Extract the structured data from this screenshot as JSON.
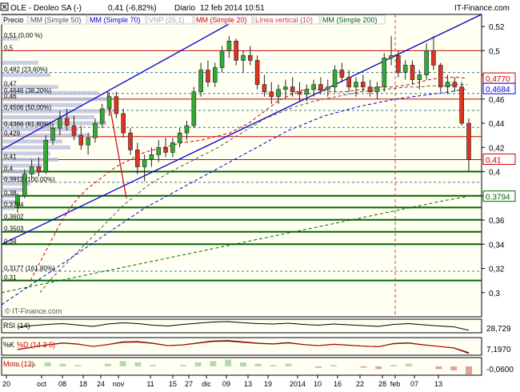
{
  "header": {
    "symbol": "OLE - Deoleo SA (-)",
    "quote": "0,41 (-6,82%)",
    "period": "Diario",
    "date": "12 feb 2014 10:51",
    "brand": "IT-Finance.com",
    "close_icon": "close-box-icon"
  },
  "legend": [
    {
      "label": "Precio",
      "color": "#000000"
    },
    {
      "label": "MM (Simple 50)",
      "color": "#555555"
    },
    {
      "label": "MM (Simple 70)",
      "color": "#0000cc"
    },
    {
      "label": "VNP (25,1)",
      "color": "#aaaaaa"
    },
    {
      "label": "MM (Simple 20)",
      "color": "#cc0000"
    },
    {
      "label": "Línea vertical (10)",
      "color": "#cc4444"
    },
    {
      "label": "MM (Simple 200)",
      "color": "#006600"
    }
  ],
  "watermark": "© IT-Finance.com",
  "indicators": {
    "rsi": {
      "label": "RSI (14)",
      "value": "28,729"
    },
    "stoch": {
      "label_k": "%K",
      "label_d": "%D (14 3 5)",
      "value": "7,1970"
    },
    "mom": {
      "label": "Mom (12)",
      "value": "-0,0600"
    }
  },
  "colors": {
    "up": "#33aa33",
    "down": "#dd3322",
    "fib": "#cc0000",
    "support": "#006600",
    "trend": "#0000cc",
    "ma50": "#555555",
    "ma20": "#cc0000",
    "ma70": "#0000cc",
    "ma200": "#006600",
    "last_price": "#cc0000"
  },
  "chart_data": {
    "type": "candlestick",
    "x_tick_labels": [
      "20",
      "oct",
      "08",
      "18",
      "24",
      "nov",
      "11",
      "15",
      "27",
      "dic",
      "09",
      "13",
      "19",
      "2014",
      "10",
      "16",
      "22",
      "28",
      "feb",
      "07",
      "13"
    ],
    "ylim": [
      0.28,
      0.53
    ],
    "y_ticks": [
      "0,52",
      "0,5",
      "0,48",
      "0,46",
      "0,44",
      "0,42",
      "0,4",
      "0,38",
      "0,36",
      "0,34",
      "0,32",
      "0,3"
    ],
    "price_tags": [
      {
        "label": "0,4770",
        "value": 0.477,
        "color": "#cc0000"
      },
      {
        "label": "0,4684",
        "value": 0.4684,
        "color": "#0000cc"
      },
      {
        "label": "0,41",
        "value": 0.41,
        "color": "#cc0000"
      },
      {
        "label": "0,3794",
        "value": 0.3794,
        "color": "#006600"
      }
    ],
    "level_labels": [
      {
        "label": "0,51 (0,00 %)",
        "value": 0.51
      },
      {
        "label": "0,5",
        "value": 0.5
      },
      {
        "label": "0,482 (23,60%)",
        "value": 0.482
      },
      {
        "label": "0,47",
        "value": 0.47
      },
      {
        "label": "0,4646 (38,20%)",
        "value": 0.4646
      },
      {
        "label": "0,46",
        "value": 0.46
      },
      {
        "label": "0,4506 (50,00%)",
        "value": 0.4506
      },
      {
        "label": "0,4366 (61,80%)",
        "value": 0.4366
      },
      {
        "label": "0,429",
        "value": 0.429
      },
      {
        "label": "0,41",
        "value": 0.41
      },
      {
        "label": "0,4",
        "value": 0.4
      },
      {
        "label": "0,3912 (100,00%)",
        "value": 0.3912
      },
      {
        "label": "0,38",
        "value": 0.38
      },
      {
        "label": "0,3704",
        "value": 0.3704
      },
      {
        "label": "0,3602",
        "value": 0.3602
      },
      {
        "label": "0,3503",
        "value": 0.3503
      },
      {
        "label": "0,34",
        "value": 0.34
      },
      {
        "label": "0,3177 (161,80%)",
        "value": 0.3177
      },
      {
        "label": "0,31",
        "value": 0.31
      }
    ],
    "red_lines": [
      0.5,
      0.46,
      0.429,
      0.41
    ],
    "green_lines": [
      0.4,
      0.38,
      0.3704,
      0.3602,
      0.3503,
      0.34,
      0.31
    ],
    "fib_dashed": [
      0.482,
      0.4646,
      0.4506,
      0.4366,
      0.3912,
      0.3177
    ],
    "candles": [
      [
        0.372,
        0.382,
        0.366,
        0.38
      ],
      [
        0.38,
        0.402,
        0.378,
        0.398
      ],
      [
        0.398,
        0.41,
        0.394,
        0.404
      ],
      [
        0.404,
        0.412,
        0.396,
        0.4
      ],
      [
        0.4,
        0.43,
        0.398,
        0.426
      ],
      [
        0.426,
        0.44,
        0.422,
        0.436
      ],
      [
        0.436,
        0.45,
        0.43,
        0.444
      ],
      [
        0.444,
        0.452,
        0.434,
        0.438
      ],
      [
        0.438,
        0.446,
        0.426,
        0.43
      ],
      [
        0.43,
        0.438,
        0.418,
        0.422
      ],
      [
        0.422,
        0.432,
        0.414,
        0.428
      ],
      [
        0.428,
        0.444,
        0.424,
        0.44
      ],
      [
        0.44,
        0.456,
        0.436,
        0.452
      ],
      [
        0.452,
        0.466,
        0.446,
        0.462
      ],
      [
        0.462,
        0.466,
        0.444,
        0.448
      ],
      [
        0.448,
        0.452,
        0.428,
        0.432
      ],
      [
        0.432,
        0.436,
        0.414,
        0.418
      ],
      [
        0.418,
        0.424,
        0.398,
        0.404
      ],
      [
        0.404,
        0.414,
        0.392,
        0.41
      ],
      [
        0.41,
        0.42,
        0.404,
        0.414
      ],
      [
        0.414,
        0.426,
        0.408,
        0.42
      ],
      [
        0.42,
        0.428,
        0.412,
        0.416
      ],
      [
        0.416,
        0.428,
        0.412,
        0.424
      ],
      [
        0.424,
        0.436,
        0.42,
        0.432
      ],
      [
        0.432,
        0.442,
        0.426,
        0.438
      ],
      [
        0.438,
        0.47,
        0.436,
        0.466
      ],
      [
        0.466,
        0.49,
        0.462,
        0.484
      ],
      [
        0.484,
        0.492,
        0.47,
        0.474
      ],
      [
        0.474,
        0.49,
        0.47,
        0.486
      ],
      [
        0.486,
        0.504,
        0.482,
        0.5
      ],
      [
        0.5,
        0.512,
        0.494,
        0.508
      ],
      [
        0.508,
        0.51,
        0.488,
        0.492
      ],
      [
        0.492,
        0.5,
        0.482,
        0.496
      ],
      [
        0.496,
        0.504,
        0.488,
        0.492
      ],
      [
        0.492,
        0.496,
        0.468,
        0.472
      ],
      [
        0.472,
        0.48,
        0.462,
        0.466
      ],
      [
        0.466,
        0.474,
        0.456,
        0.462
      ],
      [
        0.462,
        0.472,
        0.456,
        0.468
      ],
      [
        0.468,
        0.476,
        0.46,
        0.47
      ],
      [
        0.47,
        0.478,
        0.462,
        0.466
      ],
      [
        0.466,
        0.474,
        0.458,
        0.464
      ],
      [
        0.464,
        0.472,
        0.458,
        0.468
      ],
      [
        0.468,
        0.476,
        0.462,
        0.472
      ],
      [
        0.472,
        0.478,
        0.464,
        0.468
      ],
      [
        0.468,
        0.476,
        0.462,
        0.47
      ],
      [
        0.47,
        0.488,
        0.466,
        0.484
      ],
      [
        0.484,
        0.49,
        0.474,
        0.478
      ],
      [
        0.478,
        0.484,
        0.466,
        0.47
      ],
      [
        0.47,
        0.478,
        0.462,
        0.474
      ],
      [
        0.474,
        0.48,
        0.466,
        0.47
      ],
      [
        0.47,
        0.476,
        0.462,
        0.466
      ],
      [
        0.466,
        0.474,
        0.46,
        0.47
      ],
      [
        0.47,
        0.498,
        0.466,
        0.494
      ],
      [
        0.494,
        0.512,
        0.488,
        0.496
      ],
      [
        0.496,
        0.5,
        0.478,
        0.482
      ],
      [
        0.482,
        0.492,
        0.476,
        0.488
      ],
      [
        0.488,
        0.492,
        0.472,
        0.476
      ],
      [
        0.476,
        0.484,
        0.468,
        0.48
      ],
      [
        0.48,
        0.506,
        0.476,
        0.5
      ],
      [
        0.5,
        0.512,
        0.484,
        0.488
      ],
      [
        0.488,
        0.49,
        0.466,
        0.47
      ],
      [
        0.47,
        0.48,
        0.464,
        0.474
      ],
      [
        0.474,
        0.478,
        0.466,
        0.47
      ],
      [
        0.47,
        0.474,
        0.438,
        0.44
      ],
      [
        0.44,
        0.444,
        0.4,
        0.41
      ]
    ],
    "ma20_values": [
      0.31,
      0.325,
      0.34,
      0.355,
      0.368,
      0.378,
      0.386,
      0.392,
      0.398,
      0.404,
      0.408,
      0.412,
      0.416,
      0.418,
      0.42,
      0.422,
      0.424,
      0.425,
      0.426,
      0.428,
      0.43,
      0.432,
      0.436,
      0.44,
      0.446,
      0.452,
      0.458,
      0.462,
      0.466,
      0.468,
      0.468,
      0.467,
      0.466,
      0.466,
      0.467,
      0.468,
      0.469,
      0.47,
      0.47,
      0.471,
      0.472,
      0.474,
      0.476,
      0.477,
      0.478,
      0.478,
      0.477
    ],
    "ma50_values": [
      0.3,
      0.312,
      0.322,
      0.332,
      0.342,
      0.352,
      0.362,
      0.372,
      0.38,
      0.388,
      0.394,
      0.4,
      0.405,
      0.41,
      0.415,
      0.42,
      0.426,
      0.432,
      0.438,
      0.444,
      0.448,
      0.452,
      0.455,
      0.458,
      0.46,
      0.462,
      0.464,
      0.466,
      0.467,
      0.468,
      0.469,
      0.47,
      0.47,
      0.471,
      0.471,
      0.472,
      0.472
    ],
    "ma70_values": [
      0.29,
      0.3,
      0.31,
      0.32,
      0.33,
      0.34,
      0.35,
      0.36,
      0.37,
      0.378,
      0.386,
      0.394,
      0.402,
      0.41,
      0.418,
      0.426,
      0.434,
      0.44,
      0.446,
      0.45,
      0.454,
      0.457,
      0.46,
      0.462,
      0.464,
      0.466,
      0.4684
    ],
    "ma200_values": [
      0.3,
      0.304,
      0.308,
      0.312,
      0.316,
      0.32,
      0.324,
      0.328,
      0.332,
      0.336,
      0.34,
      0.344,
      0.348,
      0.352,
      0.356,
      0.36,
      0.364,
      0.368,
      0.372,
      0.376,
      0.3794
    ],
    "trend_channel": {
      "lower": [
        [
          0.0,
          0.34
        ],
        [
          1.0,
          0.53
        ]
      ],
      "upper": [
        [
          0.0,
          0.418
        ],
        [
          0.51,
          0.53
        ]
      ]
    },
    "red_diagonal": [
      [
        0.22,
        0.466
      ],
      [
        0.26,
        0.378
      ]
    ],
    "vertical_marker_fraction": 0.82,
    "rsi_values": [
      45,
      52,
      58,
      62,
      55,
      48,
      60,
      66,
      62,
      54,
      50,
      58,
      64,
      70,
      72,
      66,
      62,
      60,
      64,
      58,
      54,
      60,
      56,
      52,
      48,
      58,
      62,
      56,
      50,
      46,
      28.7
    ],
    "stoch_values": [
      30,
      45,
      60,
      72,
      65,
      50,
      62,
      78,
      80,
      70,
      55,
      60,
      72,
      84,
      86,
      78,
      70,
      66,
      74,
      62,
      55,
      64,
      58,
      52,
      48,
      68,
      72,
      60,
      50,
      40,
      7.2
    ],
    "mom_values": [
      0.01,
      0.02,
      0.03,
      0.02,
      0.01,
      0.0,
      0.02,
      0.04,
      0.03,
      0.01,
      0.0,
      0.01,
      0.03,
      0.04,
      0.05,
      0.03,
      0.02,
      0.01,
      0.02,
      0.0,
      -0.01,
      0.01,
      0.0,
      -0.01,
      -0.02,
      0.01,
      0.02,
      0.0,
      -0.02,
      -0.03,
      -0.06
    ]
  }
}
